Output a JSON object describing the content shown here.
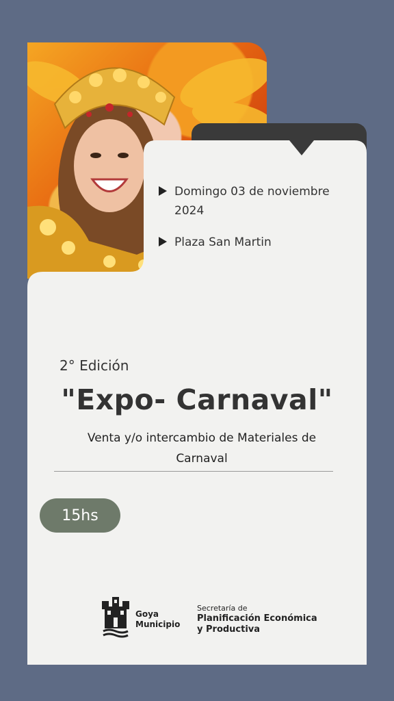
{
  "event": {
    "date": "Domingo 03 de noviembre 2024",
    "place": "Plaza San Martin",
    "edition": "2° Edición",
    "title": "\"Expo- Carnaval\"",
    "subtitle": "Venta y/o intercambio de Materiales de Carnaval",
    "time": "15hs"
  },
  "footer": {
    "goya_line1": "Goya",
    "goya_line2": "Municipio",
    "secretaria_label": "Secretaría de",
    "secretaria_line1": "Planificación Económica",
    "secretaria_line2": "y Productiva"
  },
  "colors": {
    "background": "#5e6b85",
    "card": "#f2f2f0",
    "tab": "#3a3a3a",
    "pill": "#6e7a6a"
  }
}
